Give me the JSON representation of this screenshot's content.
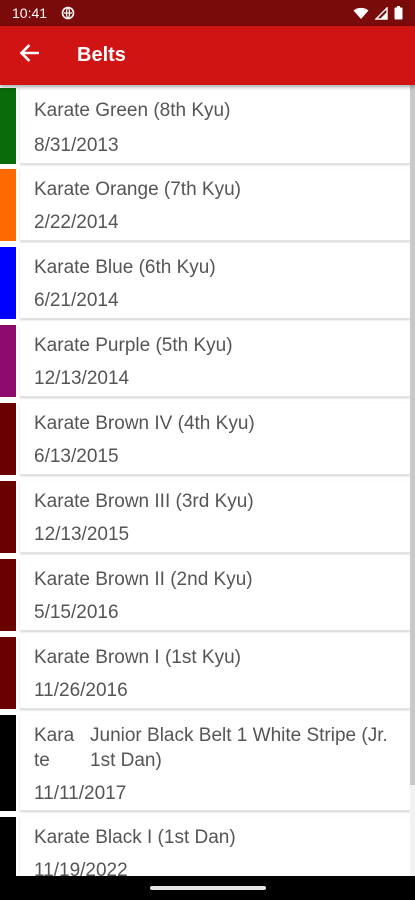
{
  "status": {
    "time": "10:41"
  },
  "app_bar": {
    "title": "Belts"
  },
  "belts": [
    {
      "name": "Karate Green (8th Kyu)",
      "date": "8/31/2013",
      "color": "#0a6b0a"
    },
    {
      "name": "Karate Orange (7th Kyu)",
      "date": "2/22/2014",
      "color": "#ff6a00"
    },
    {
      "name": "Karate Blue (6th Kyu)",
      "date": "6/21/2014",
      "color": "#0000ff"
    },
    {
      "name": "Karate Purple (5th Kyu)",
      "date": "12/13/2014",
      "color": "#8b0a6b"
    },
    {
      "name": "Karate Brown IV (4th Kyu)",
      "date": "6/13/2015",
      "color": "#6b0000"
    },
    {
      "name": "Karate Brown III (3rd Kyu)",
      "date": "12/13/2015",
      "color": "#6b0000"
    },
    {
      "name": "Karate Brown II (2nd Kyu)",
      "date": "5/15/2016",
      "color": "#6b0000"
    },
    {
      "name": "Karate Brown I (1st Kyu)",
      "date": "11/26/2016",
      "color": "#6b0000"
    },
    {
      "name_part1": "Kara te",
      "name_part2": "Junior Black Belt 1 White Stripe (Jr. 1st Dan)",
      "date": "11/11/2017",
      "color": "#000000"
    },
    {
      "name": "Karate Black I (1st Dan)",
      "date": "11/19/2022",
      "color": "#000000"
    }
  ]
}
